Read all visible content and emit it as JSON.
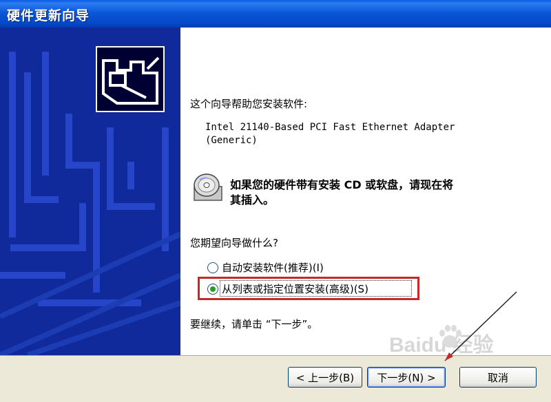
{
  "window": {
    "title": "硬件更新向导"
  },
  "intro": "这个向导帮助您安装软件:",
  "device": {
    "line1": "Intel 21140-Based PCI Fast Ethernet Adapter",
    "line2": "(Generic)"
  },
  "cd_prompt": {
    "line1": "如果您的硬件带有安装 CD 或软盘，请现在将",
    "line2": "其插入。"
  },
  "question": "您期望向导做什么?",
  "options": [
    {
      "label": "自动安装软件(推荐)(I)",
      "selected": false
    },
    {
      "label": "从列表或指定位置安装(高级)(S)",
      "selected": true
    }
  ],
  "continue_text": "要继续，请单击 “下一步”。",
  "buttons": {
    "back": "< 上一步(B)",
    "next": "下一步(N) >",
    "cancel": "取消"
  },
  "watermark": {
    "text": "Baidu 经验"
  },
  "colors": {
    "titlebar": "#0A58D8",
    "left_panel": "#102a9c",
    "highlight": "#c22a2a",
    "radio_dot": "#21a121"
  },
  "icons": [
    "hardware-card-icon",
    "cd-disc-icon",
    "baidu-paw-icon"
  ]
}
